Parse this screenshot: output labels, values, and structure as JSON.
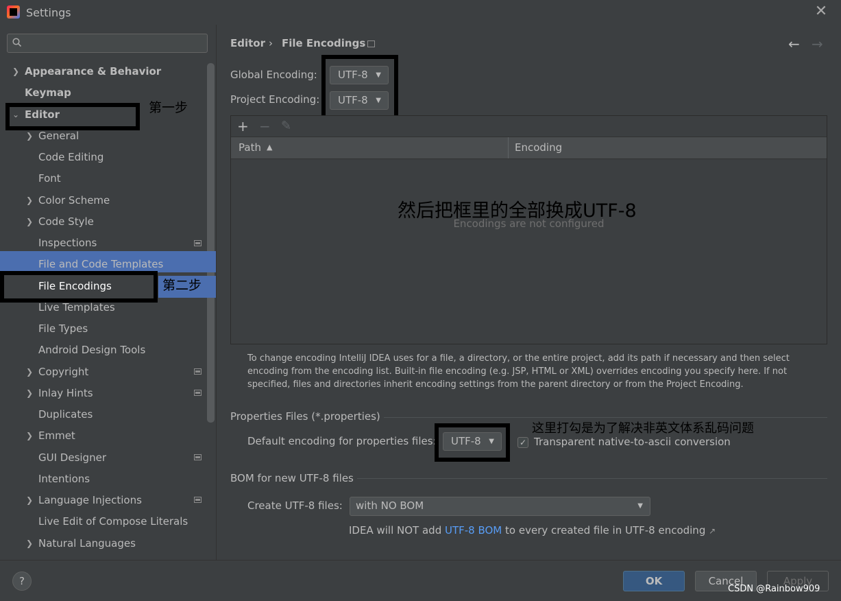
{
  "window": {
    "title": "Settings"
  },
  "sidebar": {
    "search_placeholder": "",
    "items": [
      {
        "label": "Appearance & Behavior"
      },
      {
        "label": "Keymap"
      },
      {
        "label": "Editor"
      },
      {
        "label": "General"
      },
      {
        "label": "Code Editing"
      },
      {
        "label": "Font"
      },
      {
        "label": "Color Scheme"
      },
      {
        "label": "Code Style"
      },
      {
        "label": "Inspections"
      },
      {
        "label": "File and Code Templates"
      },
      {
        "label": "File Encodings"
      },
      {
        "label": "Live Templates"
      },
      {
        "label": "File Types"
      },
      {
        "label": "Android Design Tools"
      },
      {
        "label": "Copyright"
      },
      {
        "label": "Inlay Hints"
      },
      {
        "label": "Duplicates"
      },
      {
        "label": "Emmet"
      },
      {
        "label": "GUI Designer"
      },
      {
        "label": "Intentions"
      },
      {
        "label": "Language Injections"
      },
      {
        "label": "Live Edit of Compose Literals"
      },
      {
        "label": "Natural Languages"
      }
    ]
  },
  "annotations": {
    "step1": "第一步",
    "step2": "第二步",
    "center": "然后把框里的全部换成UTF-8",
    "checkbox_note": "这里打勾是为了解决非英文体系乱码问题"
  },
  "breadcrumb": {
    "parent": "Editor",
    "separator": "›",
    "current": "File Encodings"
  },
  "encodings": {
    "global_label": "Global Encoding:",
    "global_value": "UTF-8",
    "project_label": "Project Encoding:",
    "project_value": "UTF-8"
  },
  "table": {
    "toolbar": {
      "add": "+",
      "remove": "−",
      "edit": "✎"
    },
    "columns": [
      "Path",
      "Encoding"
    ],
    "sort_indicator": "▲",
    "empty_text": "Encodings are not configured"
  },
  "help_text": "To change encoding IntelliJ IDEA uses for a file, a directory, or the entire project, add its path if necessary and then select encoding from the encoding list. Built-in file encoding (e.g. JSP, HTML or XML) overrides encoding you specify here. If not specified, files and directories inherit encoding settings from the parent directory or from the Project Encoding.",
  "properties": {
    "section_title": "Properties Files (*.properties)",
    "default_label": "Default encoding for properties files:",
    "default_value": "UTF-8",
    "transparent_label": "Transparent native-to-ascii conversion",
    "transparent_checked": true
  },
  "bom": {
    "section_title": "BOM for new UTF-8 files",
    "create_label": "Create UTF-8 files:",
    "create_value": "with NO BOM",
    "note_prefix": "IDEA will NOT add ",
    "note_link": "UTF-8 BOM",
    "note_suffix": " to every created file in UTF-8 encoding"
  },
  "footer": {
    "help": "?",
    "ok": "OK",
    "cancel": "Cancel",
    "apply": "Apply",
    "watermark": "CSDN @Rainbow909"
  },
  "colors": {
    "background": "#3c3f41",
    "selection": "#4b6eaf",
    "link": "#589df6",
    "primary_button": "#365880"
  }
}
